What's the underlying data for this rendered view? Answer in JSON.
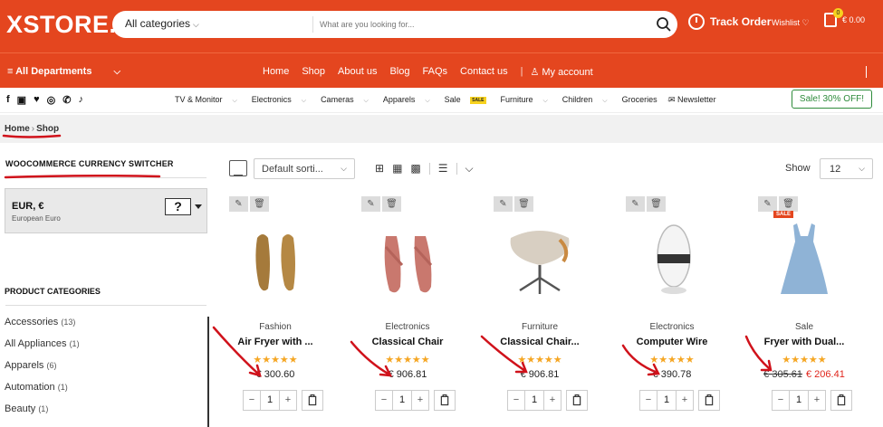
{
  "header": {
    "logo": "XSTORE.",
    "search_category": "All categories",
    "search_placeholder": "What are you looking for...",
    "track_order": "Track Order",
    "wishlist": "Wishlist",
    "cart_count": "0",
    "cart_total": "€ 0.00"
  },
  "nav": {
    "all_departments": "All Departments",
    "links": [
      "Home",
      "Shop",
      "About us",
      "Blog",
      "FAQs",
      "Contact us"
    ],
    "my_account": "My account"
  },
  "subnav": {
    "socials": [
      "f",
      "You",
      "t",
      "ig",
      "wa",
      "tk"
    ],
    "categories": [
      "TV & Monitor",
      "Electronics",
      "Cameras",
      "Apparels",
      "Sale",
      "Furniture",
      "Children",
      "Groceries"
    ],
    "sale_badge": "SALE",
    "newsletter": "Newsletter",
    "promo": "Sale! 30% OFF!"
  },
  "breadcrumb": {
    "home": "Home",
    "sep": "›",
    "current": "Shop"
  },
  "sidebar": {
    "currency_title": "WOOCOMMERCE CURRENCY SWITCHER",
    "currency_code": "EUR, €",
    "currency_name": "European Euro",
    "currency_flag": "?",
    "categories_title": "PRODUCT CATEGORIES",
    "categories": [
      {
        "name": "Accessories",
        "count": "(13)"
      },
      {
        "name": "All Appliances",
        "count": "(1)"
      },
      {
        "name": "Apparels",
        "count": "(6)"
      },
      {
        "name": "Automation",
        "count": "(1)"
      },
      {
        "name": "Beauty",
        "count": "(1)"
      }
    ]
  },
  "toolbar": {
    "sort": "Default sorti...",
    "show_label": "Show",
    "show_value": "12"
  },
  "products": [
    {
      "category": "Fashion",
      "name": "Air Fryer with ...",
      "stars": "★★★★★",
      "price": "€ 300.60",
      "old_price": "",
      "qty": "1"
    },
    {
      "category": "Electronics",
      "name": "Classical Chair",
      "stars": "★★★★★",
      "price": "€ 906.81",
      "old_price": "",
      "qty": "1"
    },
    {
      "category": "Furniture",
      "name": "Classical Chair...",
      "stars": "★★★★★",
      "price": "€ 906.81",
      "old_price": "",
      "qty": "1"
    },
    {
      "category": "Electronics",
      "name": "Computer Wire",
      "stars": "★★★★★",
      "price": "€ 390.78",
      "old_price": "",
      "qty": "1"
    },
    {
      "category": "Sale",
      "name": "Fryer with Dual...",
      "stars": "★★★★★",
      "price": "€ 206.41",
      "old_price": "€ 305.61",
      "qty": "1",
      "badge": "SALE"
    }
  ],
  "colors": {
    "brand": "#e4461f",
    "star": "#f5a623",
    "sale_price": "#e0251c",
    "annotation": "#d0121b",
    "promo": "#2e8b3b"
  }
}
